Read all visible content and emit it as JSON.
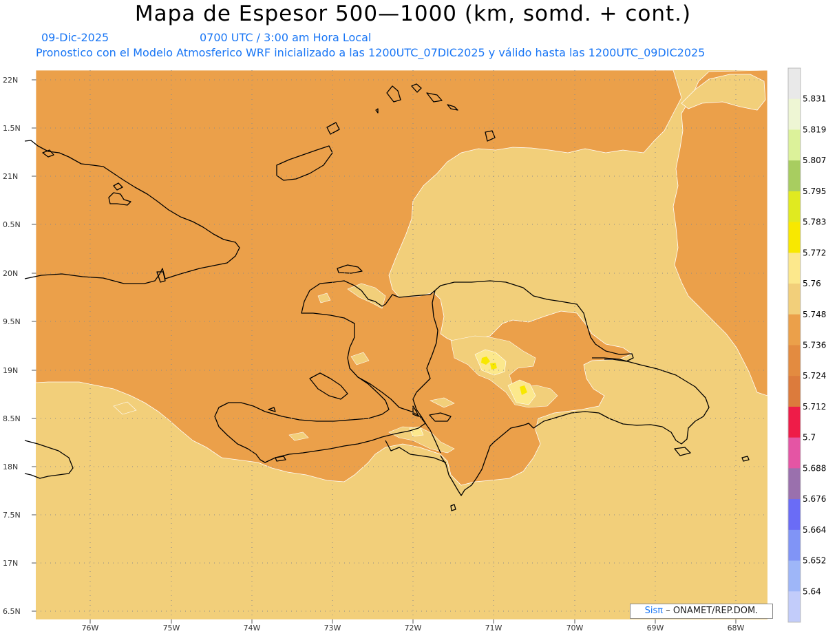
{
  "title": "Mapa de Espesor 500—1000 (km, somd. + cont.)",
  "date": "09-Dic-2025",
  "time": "0700 UTC / 3:00 am Hora Local",
  "forecast": "Pronostico con el Modelo Atmosferico WRF inicializado a las 1200UTC_07DIC2025 y válido hasta las  1200UTC_09DIC2025",
  "credit": {
    "logo": "Sisπ",
    "text": "– ONAMET/REP.DOM."
  },
  "lat_labels": [
    "22N",
    "1.5N",
    "21N",
    "0.5N",
    "20N",
    "9.5N",
    "19N",
    "8.5N",
    "18N",
    "7.5N",
    "17N",
    "6.5N"
  ],
  "lon_labels": [
    "76W",
    "75W",
    "74W",
    "73W",
    "72W",
    "71W",
    "70W",
    "69W",
    "68W"
  ],
  "colorbar": {
    "labels": [
      "5.831",
      "5.819",
      "5.807",
      "5.795",
      "5.783",
      "5.772",
      "5.76",
      "5.748",
      "5.736",
      "5.724",
      "5.712",
      "5.7",
      "5.688",
      "5.676",
      "5.664",
      "5.652",
      "5.64"
    ],
    "colors": [
      "#e9e9e9",
      "#eef6d4",
      "#dcf29a",
      "#a8cd60",
      "#e0ea20",
      "#f8e800",
      "#fce88c",
      "#f2cf7a",
      "#eba04a",
      "#e38b40",
      "#dc7b3c",
      "#ee1c48",
      "#e455a4",
      "#9a70ad",
      "#6a6cf6",
      "#8094f6",
      "#9eb6f8",
      "#c2ccfa"
    ]
  },
  "colors": {
    "warm": "#eba04a",
    "cool": "#f2cf7a",
    "pale": "#fce88c",
    "yellow": "#f8e800",
    "accent": "#1976f5"
  }
}
